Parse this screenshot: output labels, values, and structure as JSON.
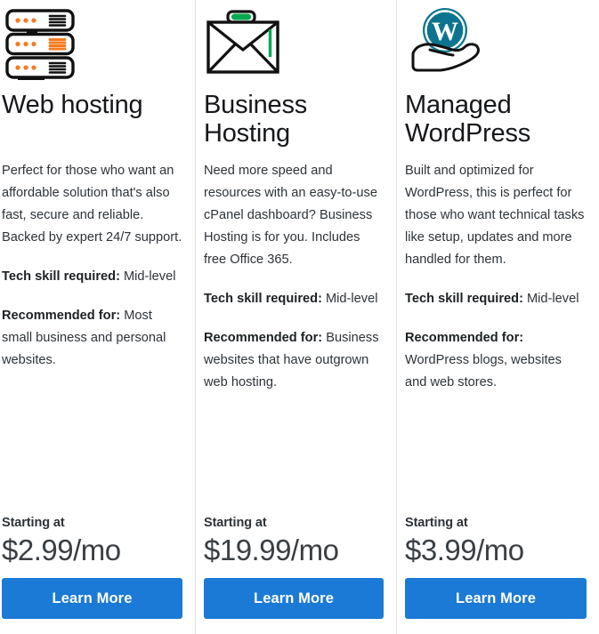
{
  "plans": [
    {
      "icon": "server-rack-icon",
      "title": "Web hosting",
      "description": "Perfect for those who want an affordable solution that's also fast, secure and reliable. Backed by expert 24/7 support.",
      "tech_skill_label": "Tech skill required:",
      "tech_skill_value": " Mid-level",
      "recommended_label": "Recommended for:",
      "recommended_value": " Most small business and personal websites.",
      "starting_label": "Starting at",
      "price": "$2.99/mo",
      "cta_label": "Learn More"
    },
    {
      "icon": "briefcase-envelope-icon",
      "title": "Business Hosting",
      "description": "Need more speed and resources with an easy-to-use cPanel dashboard? Business Hosting is for you. Includes free Office 365.",
      "tech_skill_label": "Tech skill required:",
      "tech_skill_value": " Mid-level",
      "recommended_label": "Recommended for:",
      "recommended_value": " Business websites that have outgrown web hosting.",
      "starting_label": "Starting at",
      "price": "$19.99/mo",
      "cta_label": "Learn More"
    },
    {
      "icon": "wordpress-hand-icon",
      "title": "Managed WordPress",
      "description": "Built and optimized for WordPress, this is perfect for those who want technical tasks like setup, updates and more handled for them.",
      "tech_skill_label": "Tech skill required:",
      "tech_skill_value": " Mid-level",
      "recommended_label": "Recommended for:",
      "recommended_value": " WordPress blogs, websites and web stores.",
      "starting_label": "Starting at",
      "price": "$3.99/mo",
      "cta_label": "Learn More"
    }
  ],
  "colors": {
    "cta_blue": "#1b7ad5",
    "icon_orange": "#f47b20",
    "icon_green": "#00a94f",
    "wordpress_teal": "#0d7490",
    "divider": "#e3e3e3",
    "text": "#2d3338"
  }
}
